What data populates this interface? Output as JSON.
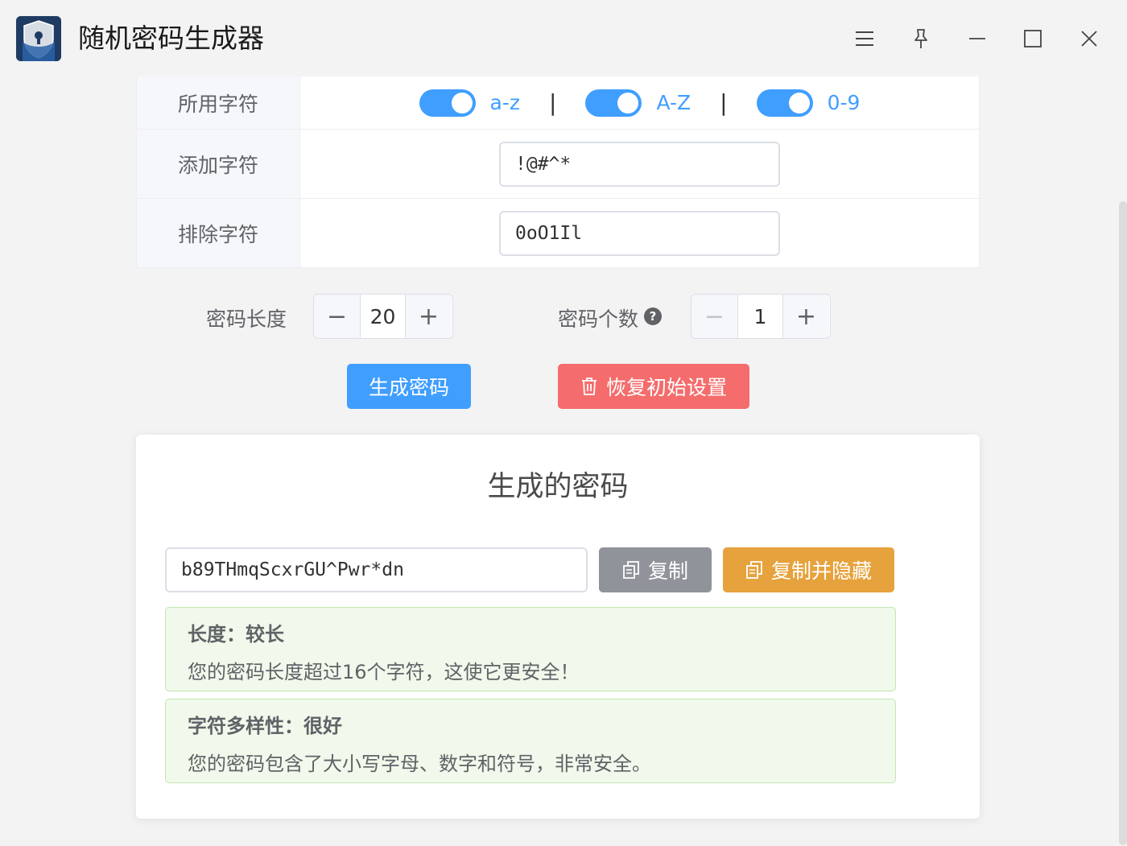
{
  "window": {
    "title": "随机密码生成器",
    "icons": [
      "app-shield-lock-icon",
      "menu-icon",
      "pin-icon",
      "minimize-icon",
      "maximize-icon",
      "close-icon"
    ]
  },
  "settings": {
    "chars_label": "所用字符",
    "switches": [
      {
        "label": "a-z",
        "on": true
      },
      {
        "label": "A-Z",
        "on": true
      },
      {
        "label": "0-9",
        "on": true
      }
    ],
    "separator": "|",
    "add_label": "添加字符",
    "add_value": "!@#^*",
    "exclude_label": "排除字符",
    "exclude_value": "0oO1Il"
  },
  "length": {
    "label": "密码长度",
    "value": "20",
    "minus": "−",
    "plus": "+"
  },
  "count": {
    "label": "密码个数",
    "help": "?",
    "value": "1",
    "minus": "−",
    "plus": "+"
  },
  "actions": {
    "generate": "生成密码",
    "reset": "恢复初始设置"
  },
  "result": {
    "title": "生成的密码",
    "password": "b89THmqScxrGU^Pwr*dn",
    "copy": "复制",
    "copy_hide": "复制并隐藏",
    "length_title": "长度：较长",
    "length_desc": "您的密码长度超过16个字符，这使它更安全！",
    "diversity_title": "字符多样性：很好",
    "diversity_desc": "您的密码包含了大小写字母、数字和符号，非常安全。"
  },
  "colors": {
    "primary": "#409eff",
    "danger": "#f56c6c",
    "info": "#909399",
    "warning": "#e6a23c",
    "success_bg": "#f0f9eb"
  }
}
